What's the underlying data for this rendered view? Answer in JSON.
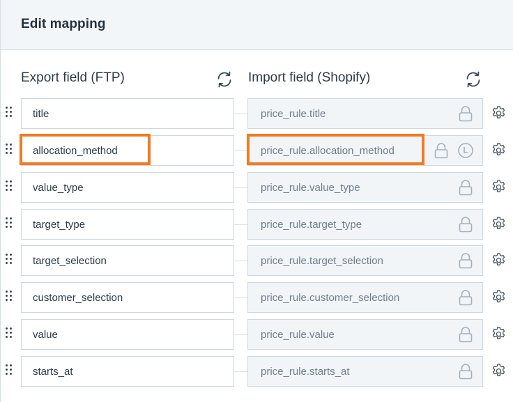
{
  "header": {
    "title": "Edit mapping"
  },
  "columns": {
    "export_label": "Export field (FTP)",
    "import_label": "Import field (Shopify)"
  },
  "rows": [
    {
      "export": "title",
      "import": "price_rule.title",
      "locked": true,
      "highlighted": false,
      "extra_icon": null
    },
    {
      "export": "allocation_method",
      "import": "price_rule.allocation_method",
      "locked": true,
      "highlighted": true,
      "extra_icon": "clock-icon"
    },
    {
      "export": "value_type",
      "import": "price_rule.value_type",
      "locked": true,
      "highlighted": false,
      "extra_icon": null
    },
    {
      "export": "target_type",
      "import": "price_rule.target_type",
      "locked": true,
      "highlighted": false,
      "extra_icon": null
    },
    {
      "export": "target_selection",
      "import": "price_rule.target_selection",
      "locked": true,
      "highlighted": false,
      "extra_icon": null
    },
    {
      "export": "customer_selection",
      "import": "price_rule.customer_selection",
      "locked": true,
      "highlighted": false,
      "extra_icon": null
    },
    {
      "export": "value",
      "import": "price_rule.value",
      "locked": true,
      "highlighted": false,
      "extra_icon": null
    },
    {
      "export": "starts_at",
      "import": "price_rule.starts_at",
      "locked": true,
      "highlighted": false,
      "extra_icon": null
    }
  ],
  "icons": {
    "refresh": "refresh-icon",
    "lock": "lock-icon",
    "settings": "gear-icon",
    "drag": "drag-handle-icon"
  },
  "colors": {
    "highlight": "#f47a20",
    "header_bg": "#f3f6f9",
    "import_bg": "#f1f5f8",
    "icon": "#a3b0bd"
  }
}
